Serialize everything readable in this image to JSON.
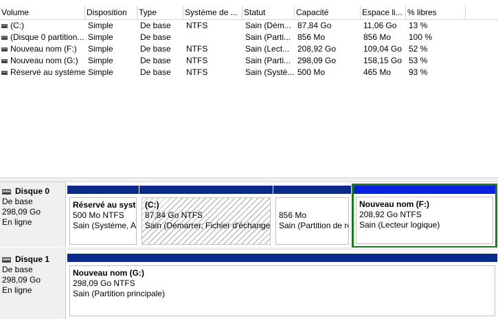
{
  "list": {
    "columns": [
      "Volume",
      "Disposition",
      "Type",
      "Système de ...",
      "Statut",
      "Capacité",
      "Espace li...",
      "% libres",
      ""
    ],
    "rows": [
      [
        "(C:)",
        "Simple",
        "De base",
        "NTFS",
        "Sain (Dém...",
        "87,84 Go",
        "11,06 Go",
        "13 %"
      ],
      [
        "(Disque 0 partition...",
        "Simple",
        "De base",
        "",
        "Sain (Parti...",
        "856 Mo",
        "856 Mo",
        "100 %"
      ],
      [
        "Nouveau nom (F:)",
        "Simple",
        "De base",
        "NTFS",
        "Sain (Lect...",
        "208,92 Go",
        "109,04 Go",
        "52 %"
      ],
      [
        "Nouveau nom (G:)",
        "Simple",
        "De base",
        "NTFS",
        "Sain (Parti...",
        "298,09 Go",
        "158,15 Go",
        "53 %"
      ],
      [
        "Réservé au système",
        "Simple",
        "De base",
        "NTFS",
        "Sain (Systè...",
        "500 Mo",
        "465 Mo",
        "93 %"
      ]
    ]
  },
  "disks": [
    {
      "name": "Disque 0",
      "type": "De base",
      "size": "298,09 Go",
      "status": "En ligne",
      "partitions": [
        {
          "name": "Réservé au système",
          "size": "500 Mo NTFS",
          "status": "Sain (Système, Actif, Partition principale)"
        },
        {
          "name": "(C:)",
          "size": "87,84 Go NTFS",
          "status": "Sain (Démarrer, Fichier d'échange, Vidage sur incident, Partition principale)"
        },
        {
          "name": "",
          "size": "856 Mo",
          "status": "Sain (Partition de récupération)"
        },
        {
          "name": "Nouveau nom  (F:)",
          "size": "208,92 Go NTFS",
          "status": "Sain (Lecteur logique)"
        }
      ]
    },
    {
      "name": "Disque 1",
      "type": "De base",
      "size": "298,09 Go",
      "status": "En ligne",
      "partitions": [
        {
          "name": "Nouveau nom  (G:)",
          "size": "298,09 Go NTFS",
          "status": "Sain (Partition principale)"
        }
      ]
    }
  ],
  "colors": {
    "primary_bar": "#0a2a8a",
    "logical_bar": "#0a20e0",
    "selection_border": "#1e7a1e"
  },
  "icons": {
    "volume": "drive-icon",
    "disk": "disk-icon"
  }
}
